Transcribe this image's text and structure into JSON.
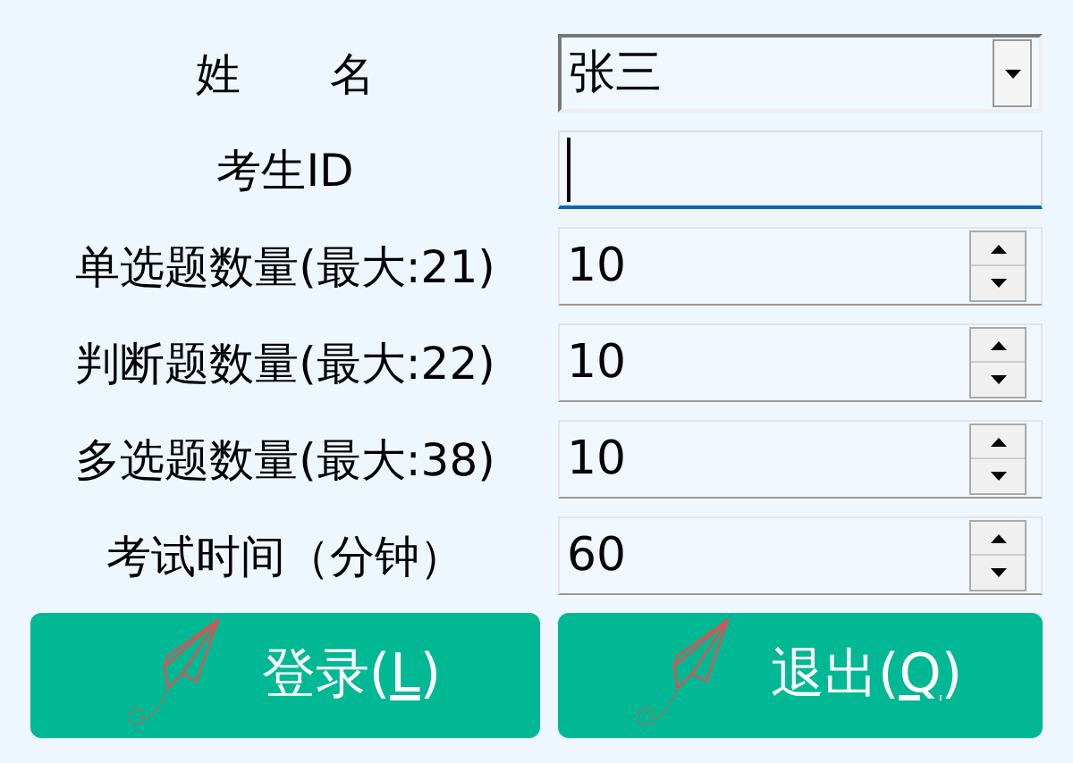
{
  "fields": [
    {
      "kind": "combo",
      "label": "姓　　名",
      "value": "张三"
    },
    {
      "kind": "text",
      "label": "考生ID",
      "focused": true
    },
    {
      "kind": "spin",
      "label": "单选题数量(最大:21)",
      "value": "10"
    },
    {
      "kind": "spin",
      "label": "判断题数量(最大:22)",
      "value": "10"
    },
    {
      "kind": "spin",
      "label": "多选题数量(最大:38)",
      "value": "10"
    },
    {
      "kind": "spin",
      "label": "考试时间（分钟）",
      "value": "60"
    }
  ],
  "buttons": [
    {
      "before": "登录(",
      "accel": "L",
      "after": ")"
    },
    {
      "before": "退出(",
      "accel": "Q",
      "after": ")"
    }
  ]
}
